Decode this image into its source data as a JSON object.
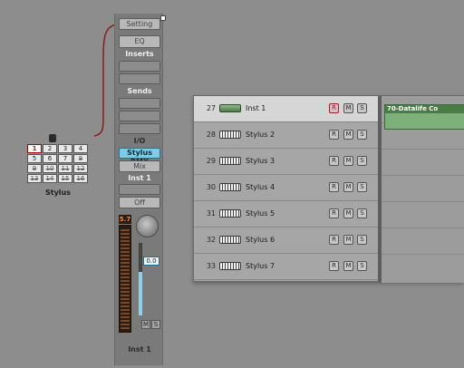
{
  "colors": {
    "background": "#8d8d8d",
    "cable": "#8b1c1c",
    "plugin_slot": "#7ecde8",
    "region": "#7db07a",
    "meter_readout": "#ff8a2a"
  },
  "stylus_object": {
    "name": "Stylus",
    "outputs": [
      "1",
      "2",
      "3",
      "4",
      "5",
      "6",
      "7",
      "8",
      "9",
      "10",
      "11",
      "12",
      "13",
      "14",
      "15",
      "16"
    ]
  },
  "channel_strip": {
    "setting_label": "Setting",
    "eq_label": "EQ",
    "inserts_label": "Inserts",
    "sends_label": "Sends",
    "io_label": "I/O",
    "input_plugin": "Stylus RMX",
    "output_label": "Mix",
    "output_name": "Inst 1",
    "automation_label": "Off",
    "meter_peak": "5.7",
    "fader_value": "0.0",
    "mute_label": "M",
    "solo_label": "S",
    "strip_name": "Inst 1",
    "icons": {
      "corner": "link-icon",
      "pan": "pan-knob-icon"
    }
  },
  "tracks": [
    {
      "number": "27",
      "name": "Inst 1",
      "selected": true,
      "icon": "instrument-tree-icon"
    },
    {
      "number": "28",
      "name": "Stylus 2",
      "selected": false,
      "icon": "keyboard-icon"
    },
    {
      "number": "29",
      "name": "Stylus 3",
      "selected": false,
      "icon": "keyboard-icon"
    },
    {
      "number": "30",
      "name": "Stylus 4",
      "selected": false,
      "icon": "keyboard-icon"
    },
    {
      "number": "31",
      "name": "Stylus 5",
      "selected": false,
      "icon": "keyboard-icon"
    },
    {
      "number": "32",
      "name": "Stylus 6",
      "selected": false,
      "icon": "keyboard-icon"
    },
    {
      "number": "33",
      "name": "Stylus 7",
      "selected": false,
      "icon": "keyboard-icon"
    }
  ],
  "track_buttons": {
    "record": "R",
    "mute": "M",
    "solo": "S"
  },
  "region": {
    "title": "70-Datalife Co"
  }
}
